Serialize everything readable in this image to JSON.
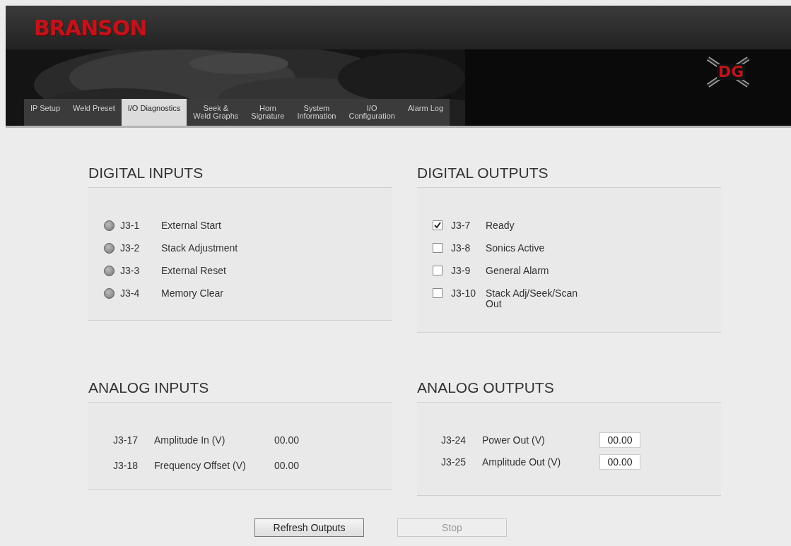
{
  "header": {
    "brand": "BRANSON",
    "product_logo": "DG"
  },
  "tabs": [
    {
      "label": "IP Setup",
      "selected": false
    },
    {
      "label": "Weld Preset",
      "selected": false
    },
    {
      "label": "I/O Diagnostics",
      "selected": true
    },
    {
      "label": "Seek &\nWeld Graphs",
      "selected": false
    },
    {
      "label": "Horn\nSignature",
      "selected": false
    },
    {
      "label": "System\nInformation",
      "selected": false
    },
    {
      "label": "I/O\nConfiguration",
      "selected": false
    },
    {
      "label": "Alarm Log",
      "selected": false
    }
  ],
  "sections": [
    {
      "title": "DIGITAL INPUTS",
      "kind": "leds",
      "rows": [
        {
          "pin": "J3-1",
          "label": "External Start",
          "on": false
        },
        {
          "pin": "J3-2",
          "label": "Stack Adjustment",
          "on": false
        },
        {
          "pin": "J3-3",
          "label": "External Reset",
          "on": false
        },
        {
          "pin": "J3-4",
          "label": "Memory Clear",
          "on": false
        }
      ]
    },
    {
      "title": "DIGITAL OUTPUTS",
      "kind": "checks",
      "rows": [
        {
          "pin": "J3-7",
          "label": "Ready",
          "checked": true
        },
        {
          "pin": "J3-8",
          "label": "Sonics Active",
          "checked": false
        },
        {
          "pin": "J3-9",
          "label": "General Alarm",
          "checked": false
        },
        {
          "pin": "J3-10",
          "label": "Stack Adj/Seek/Scan\nOut",
          "checked": false
        }
      ]
    },
    {
      "title": "ANALOG INPUTS",
      "kind": "readings",
      "rows": [
        {
          "pin": "J3-17",
          "label": "Amplitude In (V)",
          "value": "00.00"
        },
        {
          "pin": "J3-18",
          "label": "Frequency Offset (V)",
          "value": "00.00"
        }
      ]
    },
    {
      "title": "ANALOG OUTPUTS",
      "kind": "fields",
      "rows": [
        {
          "pin": "J3-24",
          "label": "Power Out (V)",
          "value": "00.00"
        },
        {
          "pin": "J3-25",
          "label": "Amplitude Out (V)",
          "value": "00.00"
        }
      ]
    }
  ],
  "buttons": [
    {
      "label": "Refresh Outputs",
      "disabled": false
    },
    {
      "label": "Stop",
      "disabled": true
    }
  ]
}
